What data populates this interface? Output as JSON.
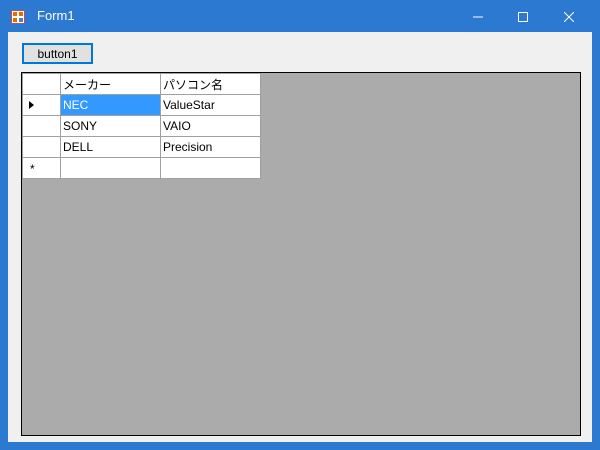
{
  "window": {
    "title": "Form1",
    "icon": "form-app-icon",
    "controls": [
      "minimize-icon",
      "maximize-icon",
      "close-icon"
    ]
  },
  "toolbar": {
    "button1_label": "button1"
  },
  "grid": {
    "columns": [
      "メーカー",
      "パソコン名"
    ],
    "rows": [
      [
        "NEC",
        "ValueStar"
      ],
      [
        "SONY",
        "VAIO"
      ],
      [
        "DELL",
        "Precision"
      ]
    ],
    "current_row_marker": "current-row-icon",
    "new_row_marker": "*",
    "selected_cell_color": "#3399ff",
    "background_color": "#ababab"
  },
  "colors": {
    "titlebar": "#2b79d0",
    "form_bg": "#f0f0f0",
    "accent": "#0078d7"
  }
}
